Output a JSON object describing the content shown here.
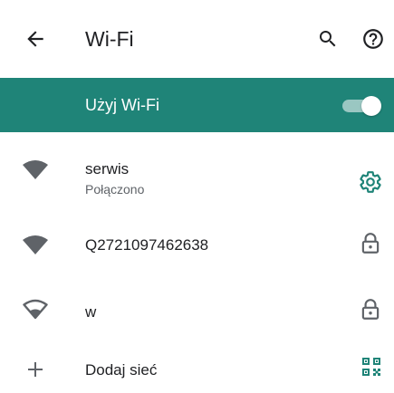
{
  "appbar": {
    "title": "Wi-Fi",
    "back_icon": "arrow-back-icon",
    "search_icon": "search-icon",
    "help_icon": "help-circle-icon"
  },
  "master_switch": {
    "label": "Użyj Wi-Fi",
    "state": "on",
    "background_color": "#1f8478"
  },
  "networks": [
    {
      "name": "serwis",
      "status": "Połączono",
      "signal_icon": "wifi-filled-icon",
      "trailing_icon": "settings-gear-icon",
      "trailing_color": "#1f8478"
    },
    {
      "name": "Q2721097462638",
      "status": "",
      "signal_icon": "wifi-filled-icon",
      "trailing_icon": "lock-icon",
      "trailing_color": "#5f6368"
    },
    {
      "name": "w",
      "status": "",
      "signal_icon": "wifi-outline-icon",
      "trailing_icon": "lock-icon",
      "trailing_color": "#5f6368"
    }
  ],
  "add_network": {
    "label": "Dodaj sieć",
    "leading_icon": "plus-icon",
    "trailing_icon": "qr-code-icon"
  }
}
